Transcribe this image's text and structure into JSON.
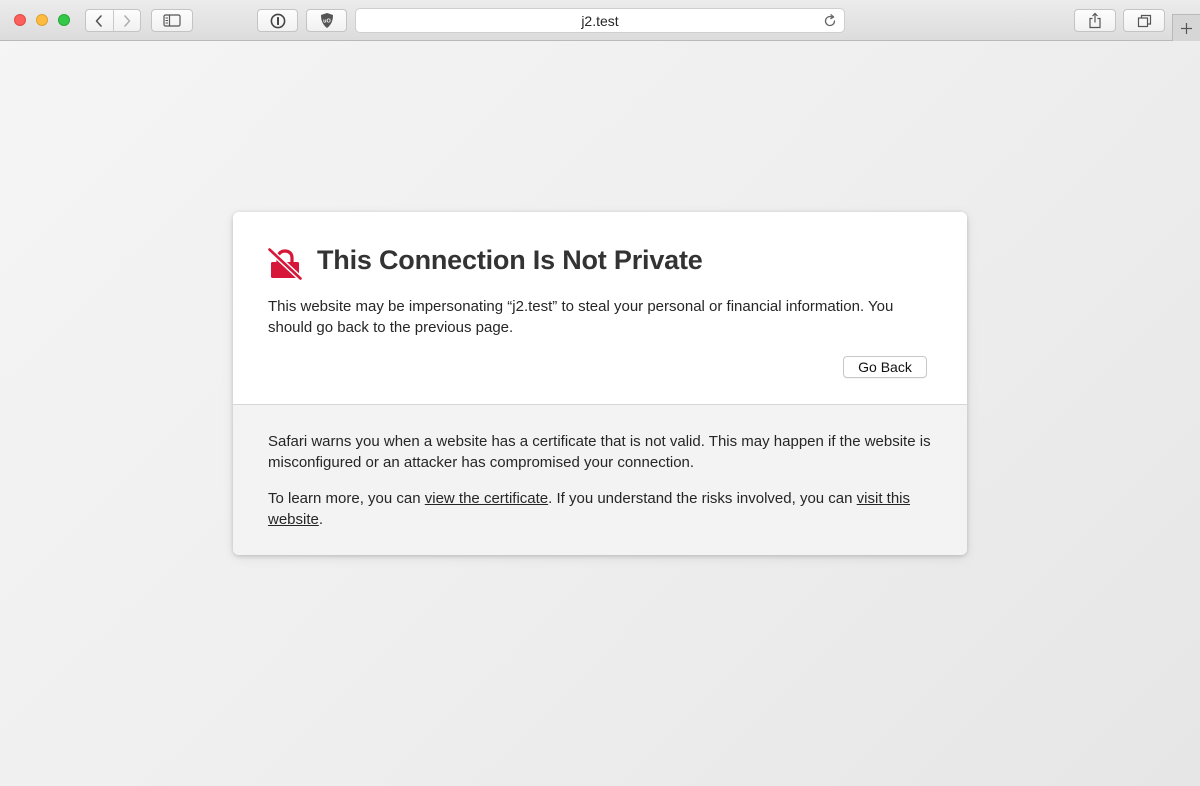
{
  "browser": {
    "url": "j2.test",
    "icons": {
      "back": "chevron-left-icon",
      "forward": "chevron-right-icon",
      "sidebar": "sidebar-icon",
      "password": "1password-icon",
      "adblock": "ublock-origin-icon",
      "reload": "reload-icon",
      "share": "share-icon",
      "tabs": "tabs-overview-icon",
      "new_tab": "plus-icon"
    }
  },
  "error": {
    "title": "This Connection Is Not Private",
    "description": "This website may be impersonating “j2.test” to steal your personal or financial information. You should go back to the previous page.",
    "go_back_label": "Go Back",
    "details": "Safari warns you when a website has a certificate that is not valid. This may happen if the website is misconfigured or an attacker has compromised your connection.",
    "learn_more_prefix": "To learn more, you can ",
    "view_certificate_link": "view the certificate",
    "learn_more_middle": ". If you understand the risks involved, you can ",
    "visit_website_link": "visit this website",
    "learn_more_suffix": ".",
    "accent_color": "#d6173a"
  }
}
